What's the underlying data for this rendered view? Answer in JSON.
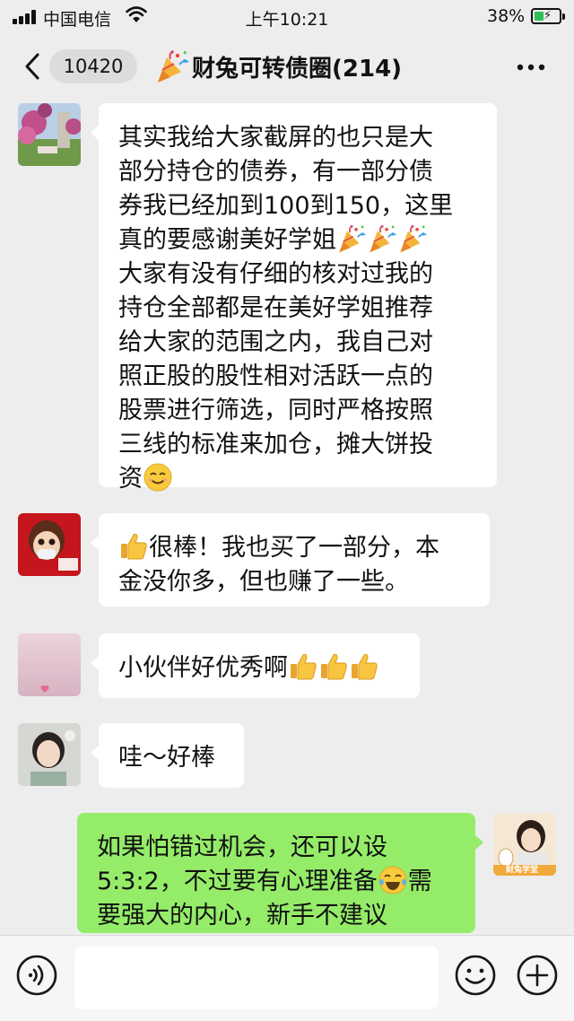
{
  "status_bar": {
    "carrier": "中国电信",
    "time": "上午10:21",
    "battery_percent": "38%",
    "icons": [
      "signal-icon",
      "wifi-icon",
      "battery-charging-icon"
    ]
  },
  "nav": {
    "back_icon": "chevron-left-icon",
    "unread_count": "10420",
    "title_emoji_icon": "party-popper-icon",
    "title": "财兔可转债圈(214)",
    "more_icon": "more-dots-icon"
  },
  "messages": [
    {
      "side": "left",
      "avatar": "flowers-avatar",
      "lines": [
        "其实我给大家截屏的也只是大",
        "部分持仓的债券，有一部分债",
        "券我已经加到100到150，这里",
        "真的要感谢美好学姐",
        "大家有没有仔细的核对过我的",
        "持仓全部都是在美好学姐推荐",
        "给大家的范围之内，我自己对",
        "照正股的股性相对活跃一点的",
        "股票进行筛选，同时严格按照",
        "三线的标准来加仓，摊大饼投",
        "资"
      ],
      "emoji_icons": [
        "party-popper-icon",
        "party-popper-icon",
        "party-popper-icon",
        "smiling-face-icon"
      ]
    },
    {
      "side": "left",
      "avatar": "cartoon-girl-mask-avatar",
      "lines": [
        "很棒！我也买了一部分，本",
        "金没你多，但也赚了一些。"
      ],
      "emoji_icons": [
        "thumbs-up-icon"
      ]
    },
    {
      "side": "left",
      "avatar": "pink-sky-avatar",
      "lines": [
        "小伙伴好优秀啊"
      ],
      "emoji_icons": [
        "thumbs-up-icon",
        "thumbs-up-icon",
        "thumbs-up-icon"
      ]
    },
    {
      "side": "left",
      "avatar": "woman-photo-avatar",
      "lines": [
        "哇～好棒"
      ],
      "emoji_icons": []
    },
    {
      "side": "right",
      "avatar": "caitu-xuetang-avatar",
      "avatar_label": "财兔学堂",
      "lines": [
        "如果怕错过机会，还可以设",
        "5:3:2，不过要有心理准备",
        "要强大的内心，新手不建议"
      ],
      "line2_tail": "需",
      "emoji_icons": [
        "tears-of-joy-icon"
      ]
    }
  ],
  "input_bar": {
    "voice_icon": "voice-icon",
    "emoji_icon": "emoji-icon",
    "add_icon": "plus-icon"
  },
  "colors": {
    "background": "#ededed",
    "bubble_self": "#95ec69",
    "bubble_other": "#ffffff"
  }
}
